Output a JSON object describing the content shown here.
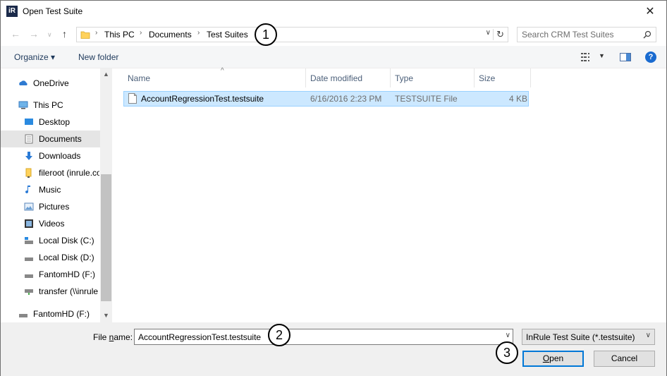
{
  "window": {
    "title": "Open Test Suite",
    "app_icon_text": "iR"
  },
  "address": {
    "crumbs": [
      "This PC",
      "Documents",
      "Test Suites"
    ],
    "search_placeholder": "Search CRM Test Suites"
  },
  "toolbar": {
    "organize": "Organize ▾",
    "new_folder": "New folder"
  },
  "navpane": {
    "items": [
      {
        "label": "OneDrive",
        "icon": "onedrive-icon"
      },
      {
        "label": "This PC",
        "icon": "computer-icon"
      },
      {
        "label": "Desktop",
        "icon": "desktop-icon"
      },
      {
        "label": "Documents",
        "icon": "documents-icon",
        "selected": true
      },
      {
        "label": "Downloads",
        "icon": "downloads-icon"
      },
      {
        "label": "fileroot (inrule.co",
        "icon": "network-folder-icon"
      },
      {
        "label": "Music",
        "icon": "music-icon"
      },
      {
        "label": "Pictures",
        "icon": "pictures-icon"
      },
      {
        "label": "Videos",
        "icon": "videos-icon"
      },
      {
        "label": "Local Disk (C:)",
        "icon": "drive-icon"
      },
      {
        "label": "Local Disk (D:)",
        "icon": "drive-icon"
      },
      {
        "label": "FantomHD (F:)",
        "icon": "drive-icon"
      },
      {
        "label": "transfer (\\\\inrule",
        "icon": "network-drive-icon"
      },
      {
        "label": "FantomHD (F:)",
        "icon": "drive-icon"
      }
    ]
  },
  "filelist": {
    "columns": [
      "Name",
      "Date modified",
      "Type",
      "Size"
    ],
    "rows": [
      {
        "name": "AccountRegressionTest.testsuite",
        "date": "6/16/2016 2:23 PM",
        "type": "TESTSUITE File",
        "size": "4 KB"
      }
    ]
  },
  "bottom": {
    "file_name_label_pre": "File ",
    "file_name_label_u": "n",
    "file_name_label_post": "ame:",
    "file_name_value": "AccountRegressionTest.testsuite",
    "file_type": "InRule Test Suite (*.testsuite)",
    "open_u": "O",
    "open_rest": "pen",
    "cancel": "Cancel"
  },
  "callouts": [
    "1",
    "2",
    "3"
  ],
  "colors": {
    "selection": "#cce8ff",
    "accent": "#0078d7"
  }
}
